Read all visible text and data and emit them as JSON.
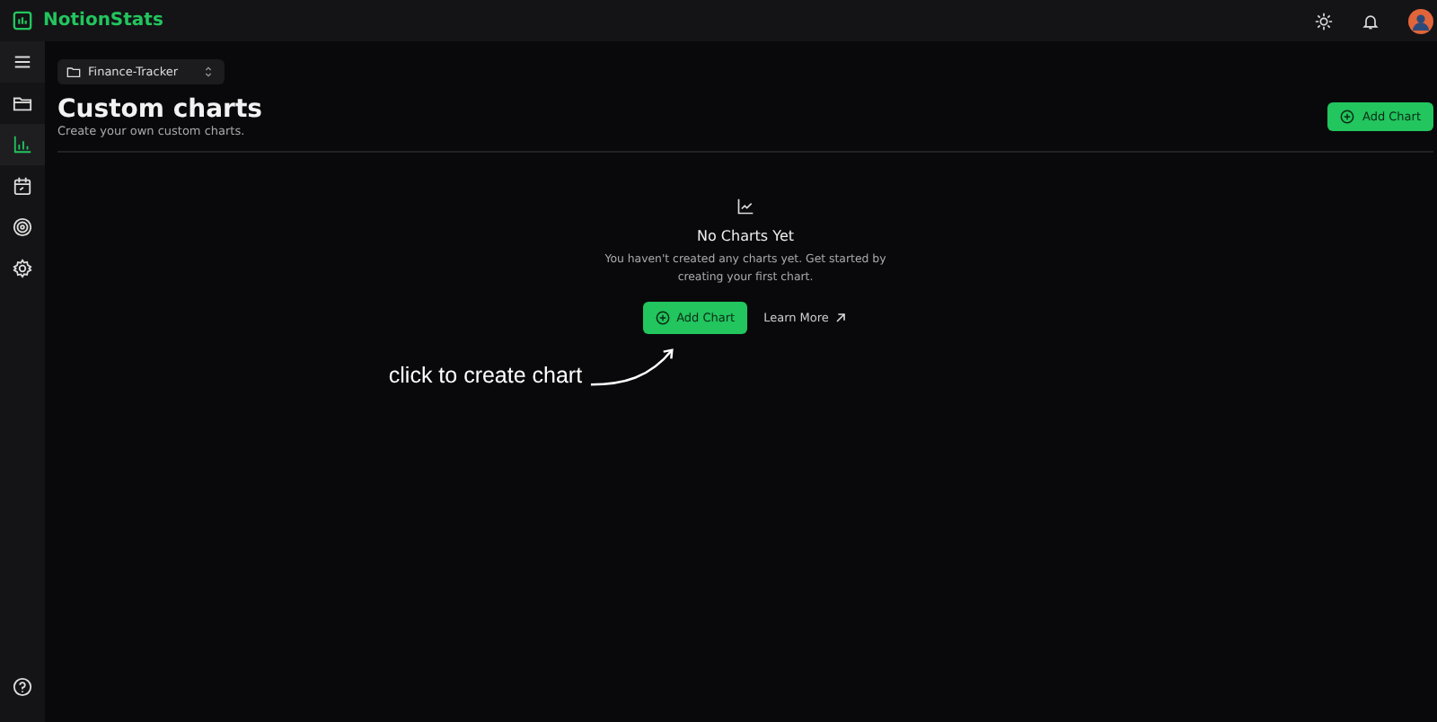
{
  "app": {
    "title": "NotionStats"
  },
  "sidebar": {
    "items": [
      {
        "kind": "folder",
        "selected": false
      },
      {
        "kind": "chart",
        "selected": true
      },
      {
        "kind": "calendar",
        "selected": false
      },
      {
        "kind": "target",
        "selected": false
      },
      {
        "kind": "settings",
        "selected": false
      }
    ]
  },
  "workspace_select": {
    "value": "Finance-Tracker"
  },
  "header": {
    "title": "Custom charts",
    "subtitle": "Create your own custom charts.",
    "button": "Add Chart"
  },
  "empty_state": {
    "title": "No Charts Yet",
    "message": "You haven't created any charts yet. Get started by creating your first chart.",
    "primary_button": "Add Chart",
    "link": "Learn More"
  },
  "annotation": {
    "text": "click to create chart"
  }
}
